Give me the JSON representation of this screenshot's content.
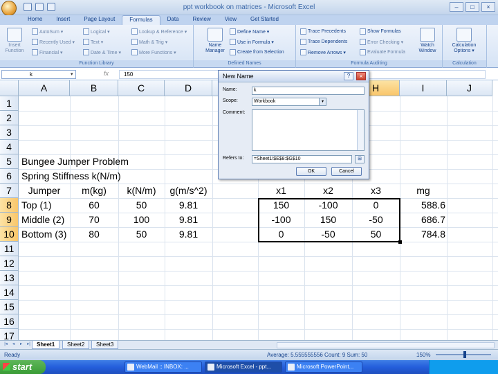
{
  "window": {
    "title": "ppt workbook on matrices - Microsoft Excel",
    "min": "–",
    "max": "□",
    "close": "×"
  },
  "tabs": [
    "Home",
    "Insert",
    "Page Layout",
    "Formulas",
    "Data",
    "Review",
    "View",
    "Get Started"
  ],
  "active_tab": "Formulas",
  "ribbon": {
    "insert_function": "Insert Function",
    "function_library": {
      "label": "Function Library",
      "autosum": "AutoSum ▾",
      "recently_used": "Recently Used ▾",
      "financial": "Financial ▾",
      "logical": "Logical ▾",
      "text": "Text ▾",
      "date_time": "Date & Time ▾",
      "lookup_reference": "Lookup & Reference ▾",
      "math_trig": "Math & Trig ▾",
      "more_functions": "More Functions ▾"
    },
    "defined_names": {
      "label": "Defined Names",
      "name_manager": "Name Manager",
      "define_name": "Define Name ▾",
      "use_in_formula": "Use in Formula ▾",
      "create_from_selection": "Create from Selection"
    },
    "formula_auditing": {
      "label": "Formula Auditing",
      "trace_precedents": "Trace Precedents",
      "trace_dependents": "Trace Dependents",
      "remove_arrows": "Remove Arrows ▾",
      "show_formulas": "Show Formulas",
      "error_checking": "Error Checking ▾",
      "evaluate_formula": "Evaluate Formula",
      "watch_window": "Watch Window"
    },
    "calculation": {
      "label": "Calculation",
      "calculation_options": "Calculation Options ▾"
    }
  },
  "formula_bar": {
    "name_box": "k",
    "fx": "fx",
    "content": "150"
  },
  "columns": [
    "A",
    "B",
    "C",
    "D",
    "E",
    "F",
    "G",
    "H",
    "I",
    "J"
  ],
  "rows": [
    "1",
    "2",
    "3",
    "4",
    "5",
    "6",
    "7",
    "8",
    "9",
    "10",
    "11",
    "12",
    "13",
    "14",
    "15",
    "16",
    "17"
  ],
  "sheet": {
    "title1": "Bungee Jumper Problem",
    "title2": "Spring Stiffness k(N/m)",
    "headers": [
      "Jumper",
      "m(kg)",
      "k(N/m)",
      "g(m/s^2)"
    ],
    "data": [
      [
        "Top (1)",
        "60",
        "50",
        "9.81"
      ],
      [
        "Middle (2)",
        "70",
        "100",
        "9.81"
      ],
      [
        "Bottom (3)",
        "80",
        "50",
        "9.81"
      ]
    ],
    "matrix_headers": [
      "x1",
      "x2",
      "x3"
    ],
    "matrix": [
      [
        "150",
        "-100",
        "0"
      ],
      [
        "-100",
        "150",
        "-50"
      ],
      [
        "0",
        "-50",
        "50"
      ]
    ],
    "mg_header": "mg",
    "mg": [
      "588.6",
      "686.7",
      "784.8"
    ]
  },
  "sheet_tabs": [
    "Sheet1",
    "Sheet2",
    "Sheet3"
  ],
  "nav_buttons": [
    "|◂",
    "◂",
    "▸",
    "▸|"
  ],
  "status": {
    "ready": "Ready",
    "stats": "Average: 5.555555556     Count: 9     Sum: 50",
    "zoom": "150%"
  },
  "taskbar": {
    "start": "start",
    "items": [
      "WebMail :: INBOX: ...",
      "Microsoft Excel - ppt...",
      "Microsoft PowerPoint..."
    ],
    "active_item": 1
  },
  "dialog": {
    "title": "New Name",
    "help": "?",
    "close": "×",
    "name_label": "Name:",
    "name_value": "k",
    "scope_label": "Scope:",
    "scope_value": "Workbook",
    "comment_label": "Comment:",
    "refers_label": "Refers to:",
    "refers_value": "=Sheet1!$E$8:$G$10",
    "ok": "OK",
    "cancel": "Cancel"
  }
}
